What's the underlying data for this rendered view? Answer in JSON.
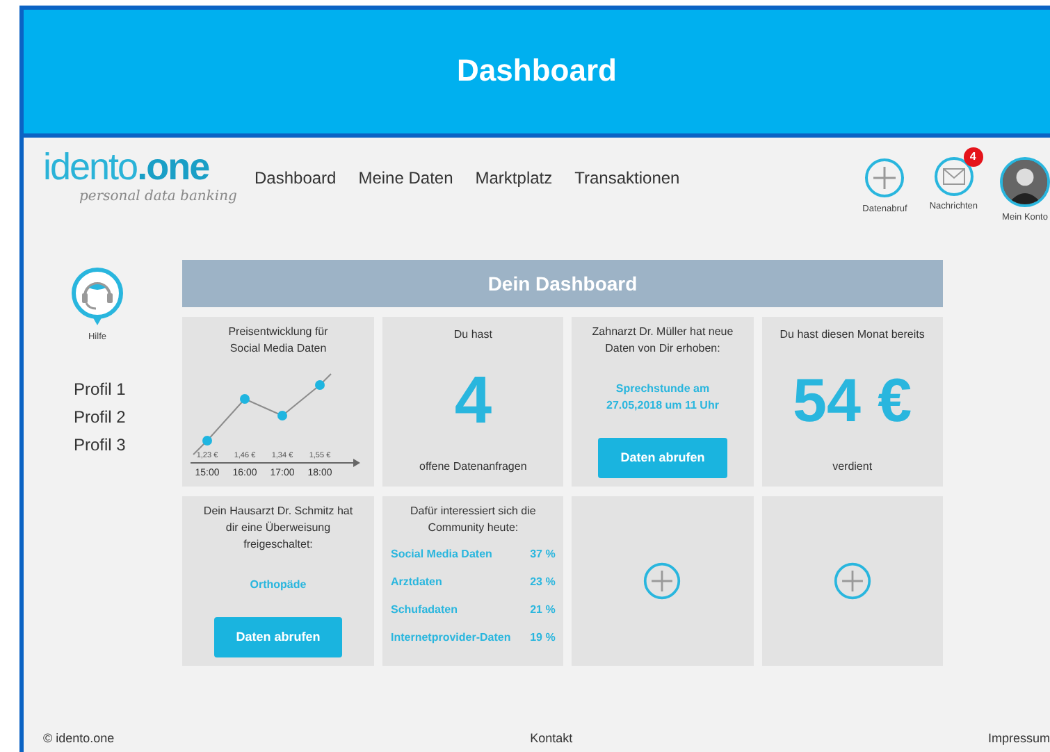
{
  "window": {
    "title": "Dashboard"
  },
  "logo": {
    "wordmark": "idento**.one**",
    "tagline": "personal data banking"
  },
  "nav": [
    "Dashboard",
    "Meine Daten",
    "Marktplatz",
    "Transaktionen"
  ],
  "actions": [
    {
      "kind": "add",
      "label": "Datenabruf"
    },
    {
      "kind": "mail",
      "label": "Nachrichten",
      "badge": "4"
    },
    {
      "kind": "account",
      "label": "Mein Konto"
    }
  ],
  "sidebar": {
    "help": "Hilfe",
    "profiles": [
      "Profil 1",
      "Profil 2",
      "Profil 3"
    ]
  },
  "dashboard": {
    "title": "Dein Dashboard",
    "tiles": [
      {
        "kind": "chart",
        "title": "Preisentwicklung für Social Media Daten",
        "points": [
          {
            "price": "1,23 €",
            "time": "15:00"
          },
          {
            "price": "1,46 €",
            "time": "16:00"
          },
          {
            "price": "1,34 €",
            "time": "17:00"
          },
          {
            "price": "1,55 €",
            "time": "18:00"
          }
        ]
      },
      {
        "kind": "counter",
        "top": "Du hast",
        "value": "4",
        "bottom": "offene Datenanfragen"
      },
      {
        "kind": "notice",
        "text": "Zahnarzt Dr. Müller hat neue Daten von Dir erhoben:",
        "highlight": "Sprechstunde am 27.05,2018 um 11 Uhr",
        "button": "Daten abrufen"
      },
      {
        "kind": "counter",
        "top": "Du hast diesen Monat bereits",
        "value": "54 €",
        "bottom": "verdient"
      },
      {
        "kind": "notice",
        "text": "Dein Hausarzt Dr. Schmitz hat dir eine Überweisung freigeschaltet:",
        "highlight": "Orthopäde",
        "button": "Daten abrufen"
      },
      {
        "kind": "list",
        "text": "Dafür interessiert sich die Community heute:",
        "items": [
          {
            "label": "Social Media Daten",
            "value": "37 %"
          },
          {
            "label": "Arztdaten",
            "value": "23 %"
          },
          {
            "label": "Schufadaten",
            "value": "21 %"
          },
          {
            "label": "Internetprovider-Daten",
            "value": "19 %"
          }
        ]
      },
      {
        "kind": "add"
      },
      {
        "kind": "add"
      }
    ]
  },
  "footer": {
    "copyright": "© idento.one",
    "links": [
      "Kontakt",
      "Impressum"
    ]
  }
}
